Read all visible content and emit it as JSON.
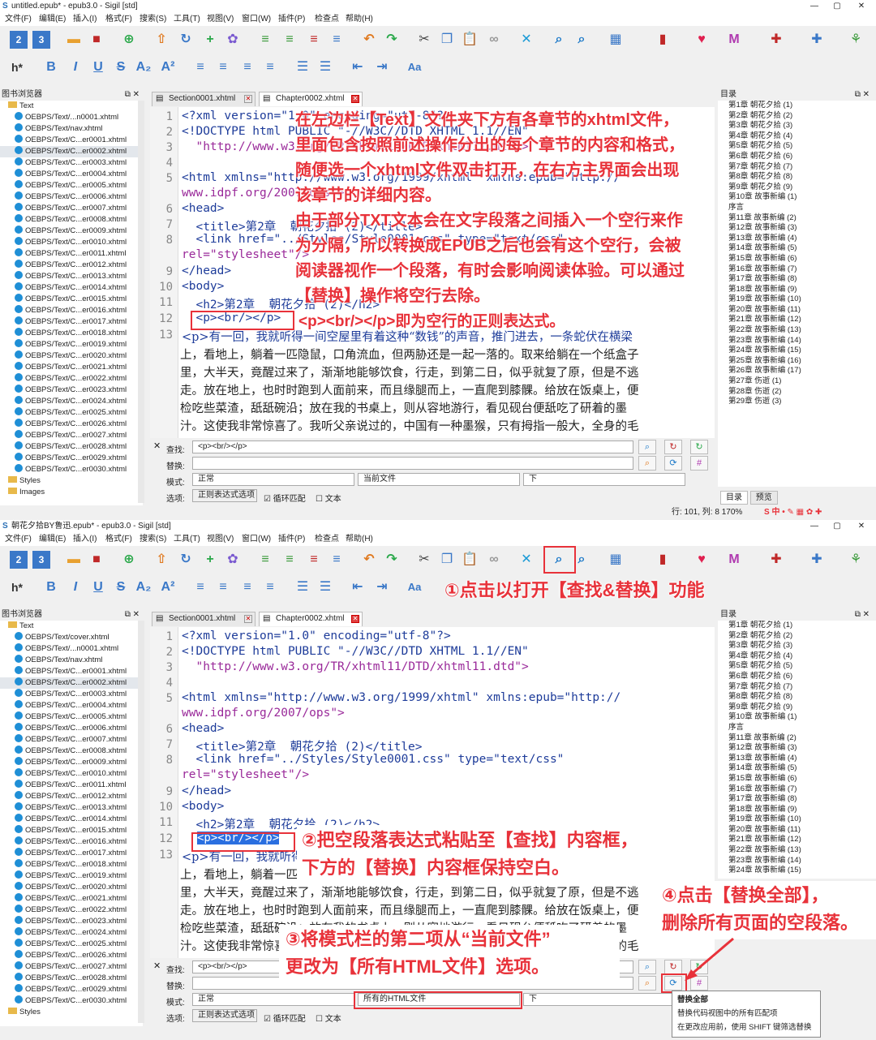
{
  "win1": {
    "title": "untitled.epub* - epub3.0 - Sigil [std]",
    "menu": [
      "文件(F)",
      "编辑(E)",
      "插入(I)",
      "格式(F)",
      "搜索(S)",
      "工具(T)",
      "视图(V)",
      "窗口(W)",
      "插件(P)",
      "检查点",
      "帮助(H)"
    ],
    "book_browser_title": "图书浏览器",
    "tree": [
      "Text",
      "OEBPS/Text/...n0001.xhtml",
      "OEBPS/Text/nav.xhtml",
      "OEBPS/Text/C...er0001.xhtml",
      "OEBPS/Text/C...er0002.xhtml",
      "OEBPS/Text/C...er0003.xhtml",
      "OEBPS/Text/C...er0004.xhtml",
      "OEBPS/Text/C...er0005.xhtml",
      "OEBPS/Text/C...er0006.xhtml",
      "OEBPS/Text/C...er0007.xhtml",
      "OEBPS/Text/C...er0008.xhtml",
      "OEBPS/Text/C...er0009.xhtml",
      "OEBPS/Text/C...er0010.xhtml",
      "OEBPS/Text/C...er0011.xhtml",
      "OEBPS/Text/C...er0012.xhtml",
      "OEBPS/Text/C...er0013.xhtml",
      "OEBPS/Text/C...er0014.xhtml",
      "OEBPS/Text/C...er0015.xhtml",
      "OEBPS/Text/C...er0016.xhtml",
      "OEBPS/Text/C...er0017.xhtml",
      "OEBPS/Text/C...er0018.xhtml",
      "OEBPS/Text/C...er0019.xhtml",
      "OEBPS/Text/C...er0020.xhtml",
      "OEBPS/Text/C...er0021.xhtml",
      "OEBPS/Text/C...er0022.xhtml",
      "OEBPS/Text/C...er0023.xhtml",
      "OEBPS/Text/C...er0024.xhtml",
      "OEBPS/Text/C...er0025.xhtml",
      "OEBPS/Text/C...er0026.xhtml",
      "OEBPS/Text/C...er0027.xhtml",
      "OEBPS/Text/C...er0028.xhtml",
      "OEBPS/Text/C...er0029.xhtml",
      "OEBPS/Text/C...er0030.xhtml",
      "Styles",
      "Images"
    ],
    "tabs": [
      "Section0001.xhtml",
      "Chapter0002.xhtml"
    ],
    "find_label": "查找:",
    "find_value": "<p><br/></p>",
    "replace_label": "替换:",
    "replace_value": "",
    "mode_label": "模式:",
    "mode_value": "正常",
    "scope_value": "当前文件",
    "direction_value": "下",
    "options_label": "选项:",
    "opt_regex": "正则表达式选项",
    "opt_wrap": "循环匹配",
    "opt_text": "文本",
    "toc_title": "目录",
    "toc": [
      "第1章 朝花夕拾 (1)",
      "第2章 朝花夕拾 (2)",
      "第3章 朝花夕拾 (3)",
      "第4章 朝花夕拾 (4)",
      "第5章 朝花夕拾 (5)",
      "第6章 朝花夕拾 (6)",
      "第7章 朝花夕拾 (7)",
      "第8章 朝花夕拾 (8)",
      "第9章 朝花夕拾 (9)",
      "第10章 故事新编 (1)",
      "序言",
      "第11章 故事新编 (2)",
      "第12章 故事新编 (3)",
      "第13章 故事新编 (4)",
      "第14章 故事新编 (5)",
      "第15章 故事新编 (6)",
      "第16章 故事新编 (7)",
      "第17章 故事新编 (8)",
      "第18章 故事新编 (9)",
      "第19章 故事新编 (10)",
      "第20章 故事新编 (11)",
      "第21章 故事新编 (12)",
      "第22章 故事新编 (13)",
      "第23章 故事新编 (14)",
      "第24章 故事新编 (15)",
      "第25章 故事新编 (16)",
      "第26章 故事新编 (17)",
      "第27章 伤逝 (1)",
      "第28章 伤逝 (2)",
      "第29章 伤逝 (3)"
    ],
    "toc_tab1": "目录",
    "toc_tab2": "预览",
    "status": "行: 101, 列: 8  170%",
    "ann_main": [
      "在左边栏【Text】文件夹下方有各章节的xhtml文件，",
      "里面包含按照前述操作分出的每个章节的内容和格式，",
      "随便选一个xhtml文件双击打开，在右方主界面会出现",
      "该章节的详细内容。",
      "由于部分TXT文本会在文字段落之间插入一个空行来作",
      "为分隔，所以转换成EPUB之后也会有这个空行，会被",
      "阅读器视作一个段落，有时会影响阅读体验。可以通过",
      "【替换】操作将空行去除。"
    ],
    "ann_regex": "<p><br/></p>即为空行的正则表达式。"
  },
  "win2": {
    "title": "朝花夕拾BY鲁迅.epub* - epub3.0 - Sigil [std]",
    "tree": [
      "Text",
      "OEBPS/Text/cover.xhtml",
      "OEBPS/Text/...n0001.xhtml",
      "OEBPS/Text/nav.xhtml",
      "OEBPS/Text/C...er0001.xhtml",
      "OEBPS/Text/C...er0002.xhtml",
      "OEBPS/Text/C...er0003.xhtml",
      "OEBPS/Text/C...er0004.xhtml",
      "OEBPS/Text/C...er0005.xhtml",
      "OEBPS/Text/C...er0006.xhtml",
      "OEBPS/Text/C...er0007.xhtml",
      "OEBPS/Text/C...er0008.xhtml",
      "OEBPS/Text/C...er0009.xhtml",
      "OEBPS/Text/C...er0010.xhtml",
      "OEBPS/Text/C...er0011.xhtml",
      "OEBPS/Text/C...er0012.xhtml",
      "OEBPS/Text/C...er0013.xhtml",
      "OEBPS/Text/C...er0014.xhtml",
      "OEBPS/Text/C...er0015.xhtml",
      "OEBPS/Text/C...er0016.xhtml",
      "OEBPS/Text/C...er0017.xhtml",
      "OEBPS/Text/C...er0018.xhtml",
      "OEBPS/Text/C...er0019.xhtml",
      "OEBPS/Text/C...er0020.xhtml",
      "OEBPS/Text/C...er0021.xhtml",
      "OEBPS/Text/C...er0022.xhtml",
      "OEBPS/Text/C...er0023.xhtml",
      "OEBPS/Text/C...er0024.xhtml",
      "OEBPS/Text/C...er0025.xhtml",
      "OEBPS/Text/C...er0026.xhtml",
      "OEBPS/Text/C...er0027.xhtml",
      "OEBPS/Text/C...er0028.xhtml",
      "OEBPS/Text/C...er0029.xhtml",
      "OEBPS/Text/C...er0030.xhtml",
      "Styles"
    ],
    "scope_value": "所有的HTML文件",
    "tooltip_title": "替换全部",
    "tooltip_line1": "替换代码视图中的所有匹配项",
    "tooltip_line2": "在更改应用前，使用 SHIFT 键筛选替换",
    "ann1": "①点击以打开【查找&替换】功能",
    "ann2a": "②把空段落表达式粘贴至【查找】内容框，",
    "ann2b": "下方的【替换】内容框保持空白。",
    "ann3a": "③将模式栏的第二项从“当前文件”",
    "ann3b": "更改为【所有HTML文件】选项。",
    "ann4a": "④点击【替换全部】，",
    "ann4b": "删除所有页面的空段落。"
  },
  "code": {
    "l1": "<?xml version=\"1.0\" encoding=\"utf-8\"?>",
    "l2": "<!DOCTYPE html PUBLIC \"-//W3C//DTD XHTML 1.1//EN\"",
    "l3": "  \"http://www.w3.org/TR/xhtml11/DTD/xhtml11.dtd\">",
    "l5a": "<html xmlns=\"http://www.w3.org/1999/xhtml\" xmlns:epub=\"http://",
    "l5b": "www.idpf.org/2007/ops\">",
    "l6": "<head>",
    "l7": "  <title>第2章  朝花夕拾 (2)</title>",
    "l8a": "  <link href=\"../Styles/Style0001.css\" type=\"text/css\"",
    "l8b": "rel=\"stylesheet\"/>",
    "l9": "</head>",
    "l10": "<body>",
    "l11": "  <h2>第2章  朝花夕拾 (2)</h2>",
    "l12": "  <p><br/></p>",
    "l13": "  <p>有一回，我就听得一间空屋里有着这种“数钱”的声音，推门进去，一条蛇伏在横梁",
    "p1": "上，看地上，躺着一匹隐鼠，口角流血，但两胁还是一起一落的。取来给躺在一个纸盒子",
    "p2": "里，大半天，竟醒过来了，渐渐地能够饮食，行走，到第二日，似乎就复了原，但是不逃",
    "p3": "走。放在地上，也时时跑到人面前来，而且缘腿而上，一直爬到膝髁。给放在饭桌上，便",
    "p4": "检吃些菜渣，舐舐碗沿；放在我的书桌上，则从容地游行，看见砚台便舐吃了研着的墨",
    "p5": "汁。这使我非常惊喜了。我听父亲说过的，中国有一种墨猴，只有拇指一般大，全身的毛"
  }
}
